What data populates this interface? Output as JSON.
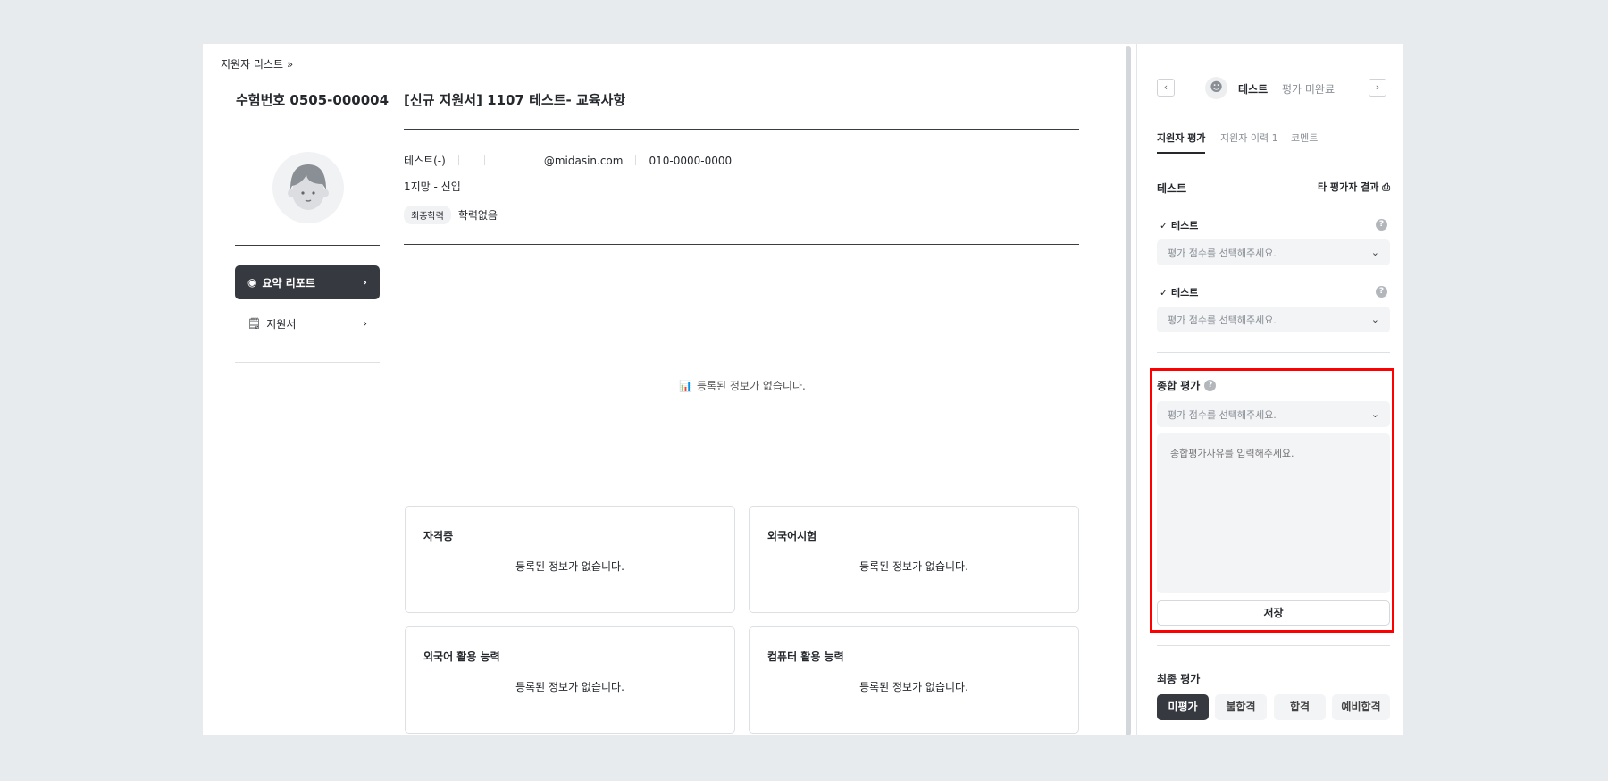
{
  "breadcrumb": {
    "label": "지원자 리스트",
    "icon": "double-chevron-right-icon",
    "sep": "»"
  },
  "left": {
    "exam_no": "수험번호 0505-000004",
    "menu": [
      {
        "label": "요약 리포트",
        "icon": "user-circle-icon",
        "active": true
      },
      {
        "label": "지원서",
        "icon": "document-edit-icon",
        "active": false
      }
    ],
    "chev": "›"
  },
  "main": {
    "title": "[신규 지원서] 1107 테스트- 교육사항",
    "name": "테스트(-)",
    "email": "@midasin.com",
    "phone": "010-0000-0000",
    "wish": "1지망 - 신입",
    "edu_tag": "최종학력",
    "edu_value": "학력없음",
    "empty": "등록된 정보가 없습니다.",
    "cards": [
      {
        "title": "자격증",
        "empty": "등록된 정보가 없습니다."
      },
      {
        "title": "외국어시험",
        "empty": "등록된 정보가 없습니다."
      },
      {
        "title": "외국어 활용 능력",
        "empty": "등록된 정보가 없습니다."
      },
      {
        "title": "컴퓨터 활용 능력",
        "empty": "등록된 정보가 없습니다."
      }
    ]
  },
  "panel": {
    "prev": "‹",
    "next": "›",
    "name": "테스트",
    "status": "평가 미완료",
    "tabs": [
      {
        "label": "지원자 평가",
        "active": true
      },
      {
        "label": "지원자 이력 1"
      },
      {
        "label": "코멘트"
      }
    ],
    "section_title": "테스트",
    "other_results": "타 평가자 결과",
    "criteria": [
      {
        "label": "✓ 테스트",
        "placeholder": "평가 점수를 선택해주세요."
      },
      {
        "label": "✓ 테스트",
        "placeholder": "평가 점수를 선택해주세요."
      }
    ],
    "overall": {
      "title": "종합 평가",
      "placeholder": "평가 점수를 선택해주세요.",
      "reason_placeholder": "종합평가사유를 입력해주세요.",
      "save": "저장"
    },
    "final": {
      "title": "최종 평가",
      "options": [
        "미평가",
        "불합격",
        "합격",
        "예비합격"
      ],
      "selected": "미평가"
    },
    "help": "?",
    "caret": "⌄"
  },
  "colors": {
    "accent_dark": "#363a40",
    "highlight": "#ff0000"
  }
}
